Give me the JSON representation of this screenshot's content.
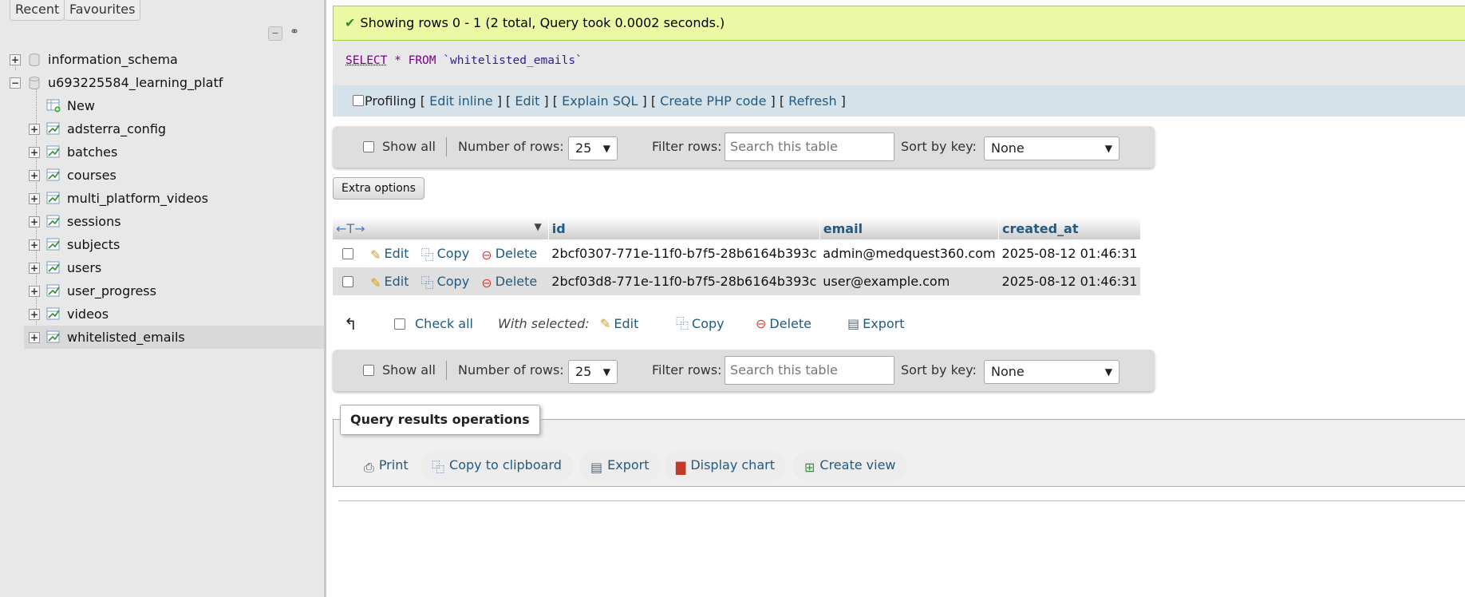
{
  "sidebar": {
    "tabs": [
      "Recent",
      "Favourites"
    ],
    "tree": [
      {
        "label": "information_schema",
        "expander": "+",
        "kind": "db"
      },
      {
        "label": "u693225584_learning_platf",
        "expander": "−",
        "kind": "db"
      },
      {
        "label": "New",
        "expander": "",
        "kind": "new"
      },
      {
        "label": "adsterra_config",
        "expander": "+",
        "kind": "table"
      },
      {
        "label": "batches",
        "expander": "+",
        "kind": "table"
      },
      {
        "label": "courses",
        "expander": "+",
        "kind": "table"
      },
      {
        "label": "multi_platform_videos",
        "expander": "+",
        "kind": "table"
      },
      {
        "label": "sessions",
        "expander": "+",
        "kind": "table"
      },
      {
        "label": "subjects",
        "expander": "+",
        "kind": "table"
      },
      {
        "label": "users",
        "expander": "+",
        "kind": "table"
      },
      {
        "label": "user_progress",
        "expander": "+",
        "kind": "table"
      },
      {
        "label": "videos",
        "expander": "+",
        "kind": "table"
      },
      {
        "label": "whitelisted_emails",
        "expander": "+",
        "kind": "table",
        "selected": true
      }
    ]
  },
  "message": "Showing rows 0 - 1 (2 total, Query took 0.0002 seconds.)",
  "sql": {
    "select": "SELECT",
    "star": "*",
    "from": "FROM",
    "table": "`whitelisted_emails`"
  },
  "profiling": {
    "label": "Profiling",
    "links": [
      "Edit inline",
      "Edit",
      "Explain SQL",
      "Create PHP code",
      "Refresh"
    ]
  },
  "nav": {
    "show_all": "Show all",
    "rows_label": "Number of rows:",
    "rows_value": "25",
    "filter_label": "Filter rows:",
    "filter_placeholder": "Search this table",
    "sort_label": "Sort by key:",
    "sort_value": "None"
  },
  "extra_options": "Extra options",
  "table": {
    "arrows": "←T→",
    "columns": [
      "id",
      "email",
      "created_at"
    ],
    "actions": {
      "edit": "Edit",
      "copy": "Copy",
      "delete": "Delete"
    },
    "rows": [
      {
        "id": "2bcf0307-771e-11f0-b7f5-28b6164b393c",
        "email": "admin@medquest360.com",
        "created_at": "2025-08-12 01:46:31"
      },
      {
        "id": "2bcf03d8-771e-11f0-b7f5-28b6164b393c",
        "email": "user@example.com",
        "created_at": "2025-08-12 01:46:31"
      }
    ]
  },
  "with_selected": {
    "check_all": "Check all",
    "label": "With selected:",
    "edit": "Edit",
    "copy": "Copy",
    "delete": "Delete",
    "export": "Export"
  },
  "operations": {
    "title": "Query results operations",
    "buttons": [
      "Print",
      "Copy to clipboard",
      "Export",
      "Display chart",
      "Create view"
    ]
  },
  "colors": {
    "success_bg": "#ebf8a4",
    "link": "#235a81",
    "profiling_bg": "#d6e2ea"
  }
}
